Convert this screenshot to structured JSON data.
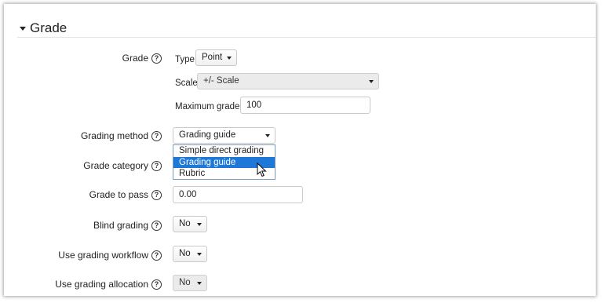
{
  "section": {
    "title": "Grade"
  },
  "grade": {
    "label": "Grade",
    "type_label": "Type",
    "type_value": "Point",
    "scale_label": "Scale",
    "scale_value": "+/- Scale",
    "max_grade_label": "Maximum grade",
    "max_grade_value": "100"
  },
  "grading_method": {
    "label": "Grading method",
    "value": "Grading guide",
    "options": [
      "Simple direct grading",
      "Grading guide",
      "Rubric"
    ],
    "highlighted_index": 1
  },
  "grade_category": {
    "label": "Grade category"
  },
  "grade_to_pass": {
    "label": "Grade to pass",
    "value": "0.00"
  },
  "blind_grading": {
    "label": "Blind grading",
    "value": "No"
  },
  "grading_workflow": {
    "label": "Use grading workflow",
    "value": "No"
  },
  "grading_allocation": {
    "label": "Use grading allocation",
    "value": "No"
  },
  "colors": {
    "highlight": "#1e78d8",
    "dropdown_border": "#7a9cc2"
  }
}
